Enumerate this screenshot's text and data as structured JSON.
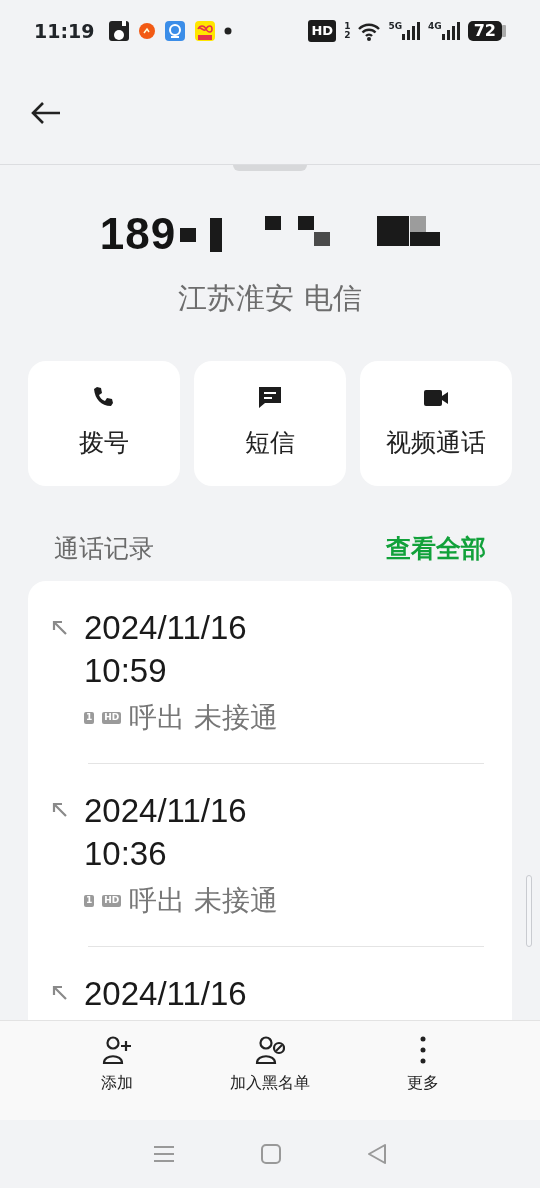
{
  "status_bar": {
    "time": "11:19",
    "hd": "HD",
    "hd_sims": [
      "1",
      "2"
    ],
    "networks": [
      "5G",
      "4G"
    ],
    "battery": "72"
  },
  "contact": {
    "number_visible": "189",
    "location": "江苏淮安 电信"
  },
  "actions": [
    {
      "kind": "call",
      "label": "拨号"
    },
    {
      "kind": "message",
      "label": "短信"
    },
    {
      "kind": "video",
      "label": "视频通话"
    }
  ],
  "call_log": {
    "title": "通话记录",
    "view_all": "查看全部",
    "entries": [
      {
        "date": "2024/11/16",
        "time": "10:59",
        "sim": "1",
        "hd": "HD",
        "status": "呼出 未接通"
      },
      {
        "date": "2024/11/16",
        "time": "10:36",
        "sim": "1",
        "hd": "HD",
        "status": "呼出 未接通"
      },
      {
        "date": "2024/11/16"
      }
    ]
  },
  "bottom_actions": [
    {
      "kind": "add",
      "label": "添加"
    },
    {
      "kind": "block",
      "label": "加入黑名单"
    },
    {
      "kind": "more",
      "label": "更多"
    }
  ]
}
